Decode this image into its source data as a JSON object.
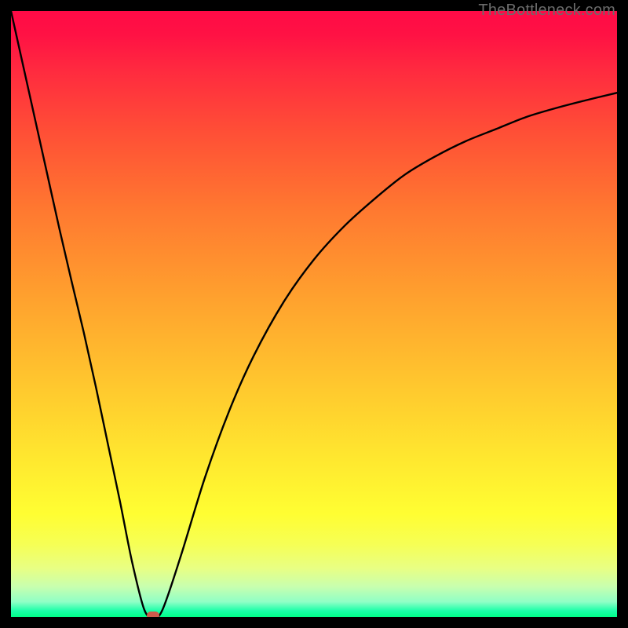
{
  "watermark": "TheBottleneck.com",
  "chart_data": {
    "type": "line",
    "title": "",
    "xlabel": "",
    "ylabel": "",
    "xlim": [
      0,
      100
    ],
    "ylim": [
      0,
      100
    ],
    "series": [
      {
        "name": "curve",
        "x": [
          0,
          2,
          4,
          6,
          8,
          10,
          12,
          14,
          16,
          18,
          20,
          22,
          23.5,
          25,
          28,
          32,
          36,
          40,
          45,
          50,
          55,
          60,
          65,
          70,
          75,
          80,
          85,
          90,
          95,
          100
        ],
        "y": [
          100,
          91,
          82,
          73,
          64,
          55.4,
          47,
          38,
          28.5,
          19,
          9,
          1.2,
          0.0,
          1.2,
          10,
          23,
          34,
          43,
          52,
          59,
          64.5,
          69,
          73,
          76,
          78.5,
          80.5,
          82.5,
          84,
          85.3,
          86.5
        ]
      }
    ],
    "marker": {
      "x": 23.5,
      "y": 0.0,
      "color": "#cf5b4c"
    },
    "background_gradient": {
      "top": "#ff0a46",
      "bottom": "#00ff88"
    }
  }
}
